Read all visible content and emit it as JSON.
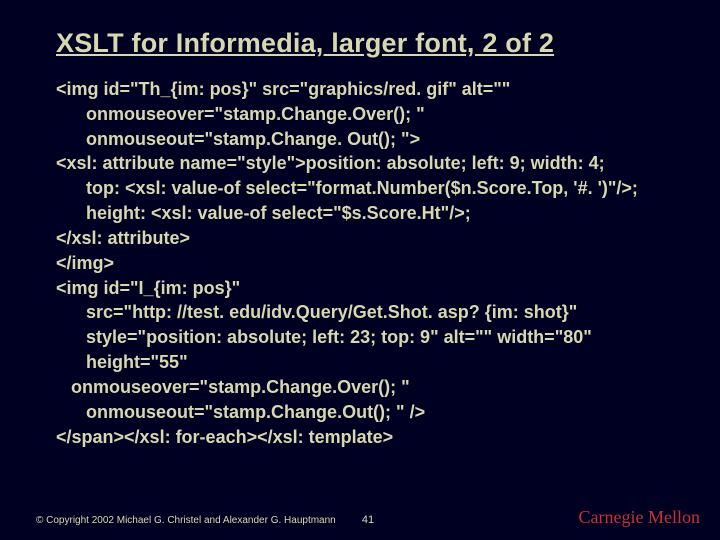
{
  "title": "XSLT for Informedia, larger font, 2 of 2",
  "code_lines": [
    "<img id=\"Th_{im: pos}\" src=\"graphics/red. gif\" alt=\"\"",
    "      onmouseover=\"stamp.Change.Over(); \"",
    "      onmouseout=\"stamp.Change. Out(); \">",
    "<xsl: attribute name=\"style\">position: absolute; left: 9; width: 4;",
    "      top: <xsl: value-of select=\"format.Number($n.Score.Top, '#. ')\"/>;",
    "      height: <xsl: value-of select=\"$s.Score.Ht\"/>;",
    "</xsl: attribute>",
    "</img>",
    "<img id=\"I_{im: pos}\"",
    "      src=\"http: //test. edu/idv.Query/Get.Shot. asp? {im: shot}\"",
    "      style=\"position: absolute; left: 23; top: 9\" alt=\"\" width=\"80\"",
    "      height=\"55\"",
    "   onmouseover=\"stamp.Change.Over(); \"",
    "      onmouseout=\"stamp.Change.Out(); \" />",
    "</span></xsl: for-each></xsl: template>"
  ],
  "footer": {
    "copyright": "© Copyright 2002  Michael G. Christel and Alexander G. Hauptmann",
    "page": "41",
    "brand": "Carnegie Mellon"
  }
}
